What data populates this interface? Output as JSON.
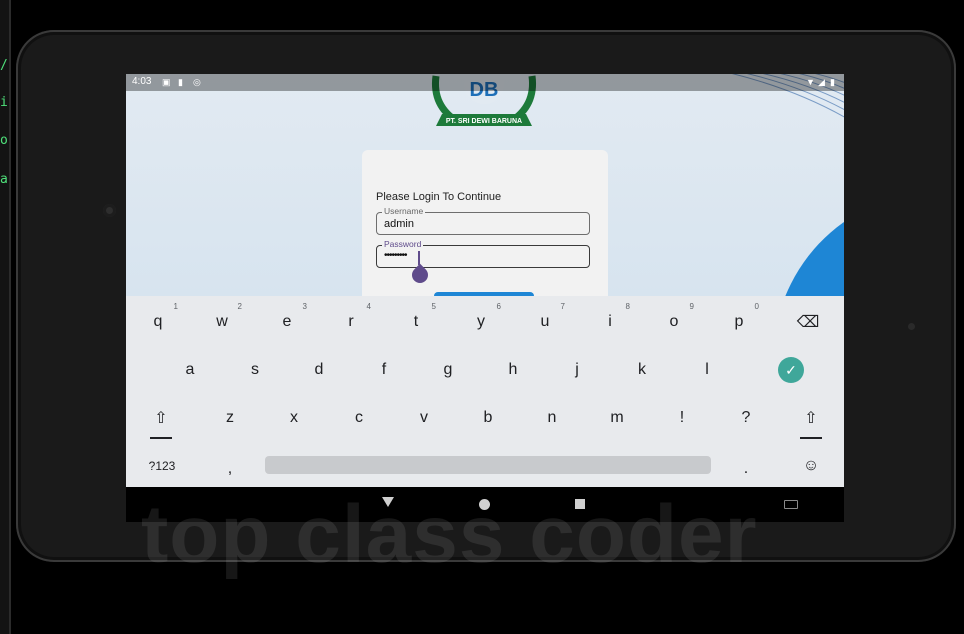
{
  "editor_strip": {
    "chars": [
      "/",
      "i",
      "o",
      "a"
    ]
  },
  "status_bar": {
    "time": "4:03",
    "icons": [
      "sim-card-icon",
      "sd-card-icon",
      "sync-icon",
      "wifi-icon",
      "signal-icon",
      "battery-icon"
    ]
  },
  "logo": {
    "monogram": "DB",
    "company": "PT. SRI DEWI BARUNA"
  },
  "login": {
    "prompt": "Please Login To Continue",
    "username_label": "Username",
    "username_value": "admin",
    "password_label": "Password",
    "password_value": "•••••••••"
  },
  "keyboard": {
    "row1": [
      "q",
      "w",
      "e",
      "r",
      "t",
      "y",
      "u",
      "i",
      "o",
      "p"
    ],
    "row1_hints": [
      "1",
      "2",
      "3",
      "4",
      "5",
      "6",
      "7",
      "8",
      "9",
      "0"
    ],
    "row2": [
      "a",
      "s",
      "d",
      "f",
      "g",
      "h",
      "j",
      "k",
      "l"
    ],
    "row3": [
      "z",
      "x",
      "c",
      "v",
      "b",
      "n",
      "m",
      "!",
      "?"
    ],
    "symbols_label": "?123",
    "comma": ",",
    "period": ".",
    "emoji": "☺",
    "backspace": "⌫",
    "shift": "⇧",
    "done": "✓"
  },
  "watermark": "top class coder",
  "colors": {
    "accent_blue": "#1e86d5",
    "cursor_purple": "#5f4b8b",
    "done_teal": "#3fa79a",
    "logo_green": "#1d7a3a"
  }
}
